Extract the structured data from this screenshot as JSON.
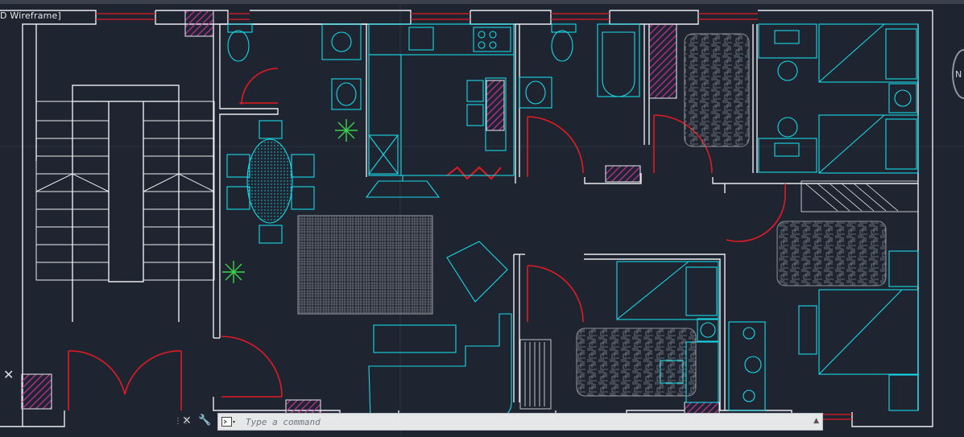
{
  "viewport": {
    "label": "D Wireframe]"
  },
  "command_line": {
    "placeholder": "Type a command"
  },
  "compass": {
    "letter": "N"
  },
  "colors": {
    "wall": "#e9ecef",
    "door": "#e01b24",
    "furniture": "#18d8e8",
    "hatch": "#c0309a",
    "background": "#1f2530"
  }
}
